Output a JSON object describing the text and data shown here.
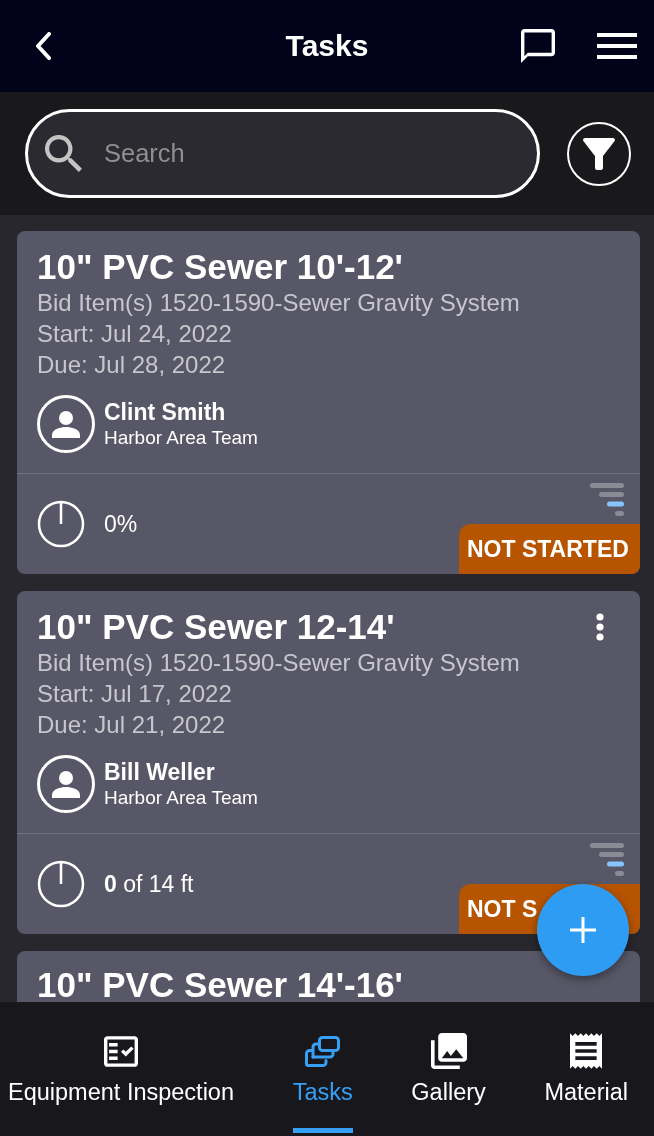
{
  "top_bar": {
    "title": "Tasks"
  },
  "search": {
    "placeholder": "Search"
  },
  "tasks": [
    {
      "title": "10\" PVC Sewer 10'-12'",
      "bid_items": "Bid Item(s) 1520-1590-Sewer Gravity System",
      "start": "Start: Jul 24, 2022",
      "due": "Due: Jul 28, 2022",
      "assignee": {
        "name": "Clint Smith",
        "team": "Harbor Area Team"
      },
      "level": 0,
      "progress": "0%",
      "status": "NOT STARTED",
      "menu": false
    },
    {
      "title": "10\" PVC Sewer 12-14'",
      "bid_items": "Bid Item(s) 1520-1590-Sewer Gravity System",
      "start": "Start: Jul 17, 2022",
      "due": "Due: Jul 21, 2022",
      "assignee": {
        "name": "Bill Weller",
        "team": "Harbor Area Team"
      },
      "level": 0,
      "progress": "**0** of 14 ft",
      "status": "NOT S",
      "menu": true
    },
    {
      "title": "10\" PVC Sewer 14'-16'",
      "menu": false
    }
  ],
  "bottom_nav": [
    {
      "kind": "checklist",
      "label": "Equipment Inspection",
      "selected": false
    },
    {
      "kind": "tasks",
      "label": "Tasks",
      "selected": true
    },
    {
      "kind": "gallery",
      "label": "Gallery",
      "selected": false
    },
    {
      "kind": "receipt",
      "label": "Material",
      "selected": false
    }
  ]
}
